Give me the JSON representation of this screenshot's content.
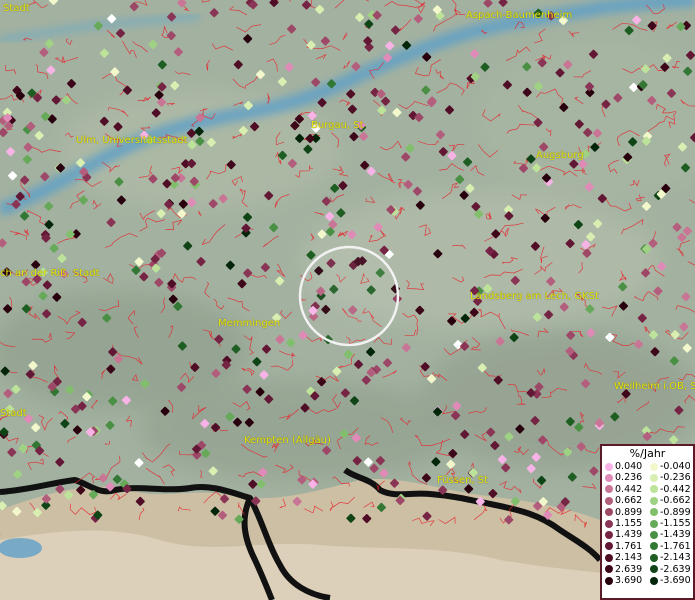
{
  "places": [
    {
      "id": "stadt-top",
      "name": "Stadt"
    },
    {
      "id": "aspach",
      "name": "Aspach-Baumenheim"
    },
    {
      "id": "ulm",
      "name": "Ulm, Universitätsstadt"
    },
    {
      "id": "burgau",
      "name": "Burgau, St"
    },
    {
      "id": "augsburg",
      "name": "Augsburg"
    },
    {
      "id": "riss",
      "name": "ch an der Riß, Stadt"
    },
    {
      "id": "landsberg",
      "name": "Landsberg am Lech, GKSt"
    },
    {
      "id": "memmingen",
      "name": "Memmingen"
    },
    {
      "id": "weilheim",
      "name": "Weilheim i.OB, St"
    },
    {
      "id": "stadt-left",
      "name": "Stadt"
    },
    {
      "id": "kempten",
      "name": "Kempten (Allgäu)"
    },
    {
      "id": "fussen",
      "name": "Füssen, St"
    }
  ],
  "legend": {
    "title": "%/Jahr",
    "positive": [
      {
        "label": "0.040",
        "color": "#f7b3e6"
      },
      {
        "label": "0.236",
        "color": "#e08ab8"
      },
      {
        "label": "0.442",
        "color": "#c97596"
      },
      {
        "label": "0.662",
        "color": "#b45e7e"
      },
      {
        "label": "0.899",
        "color": "#9e4868"
      },
      {
        "label": "1.155",
        "color": "#8a3555"
      },
      {
        "label": "1.439",
        "color": "#762444"
      },
      {
        "label": "1.761",
        "color": "#621834"
      },
      {
        "label": "2.143",
        "color": "#500d26"
      },
      {
        "label": "2.639",
        "color": "#3d0619"
      },
      {
        "label": "3.690",
        "color": "#28000d"
      }
    ],
    "negative": [
      {
        "label": "-0.040",
        "color": "#f2f7cc"
      },
      {
        "label": "-0.236",
        "color": "#d9efb1"
      },
      {
        "label": "-0.442",
        "color": "#bde39a"
      },
      {
        "label": "-0.662",
        "color": "#9fd283"
      },
      {
        "label": "-0.899",
        "color": "#82bf6c"
      },
      {
        "label": "-1.155",
        "color": "#66a958"
      },
      {
        "label": "-1.439",
        "color": "#4a9044"
      },
      {
        "label": "-1.761",
        "color": "#327733"
      },
      {
        "label": "-2.143",
        "color": "#1f5e23"
      },
      {
        "label": "-2.639",
        "color": "#0f4416"
      },
      {
        "label": "-3.690",
        "color": "#03260a"
      }
    ]
  }
}
